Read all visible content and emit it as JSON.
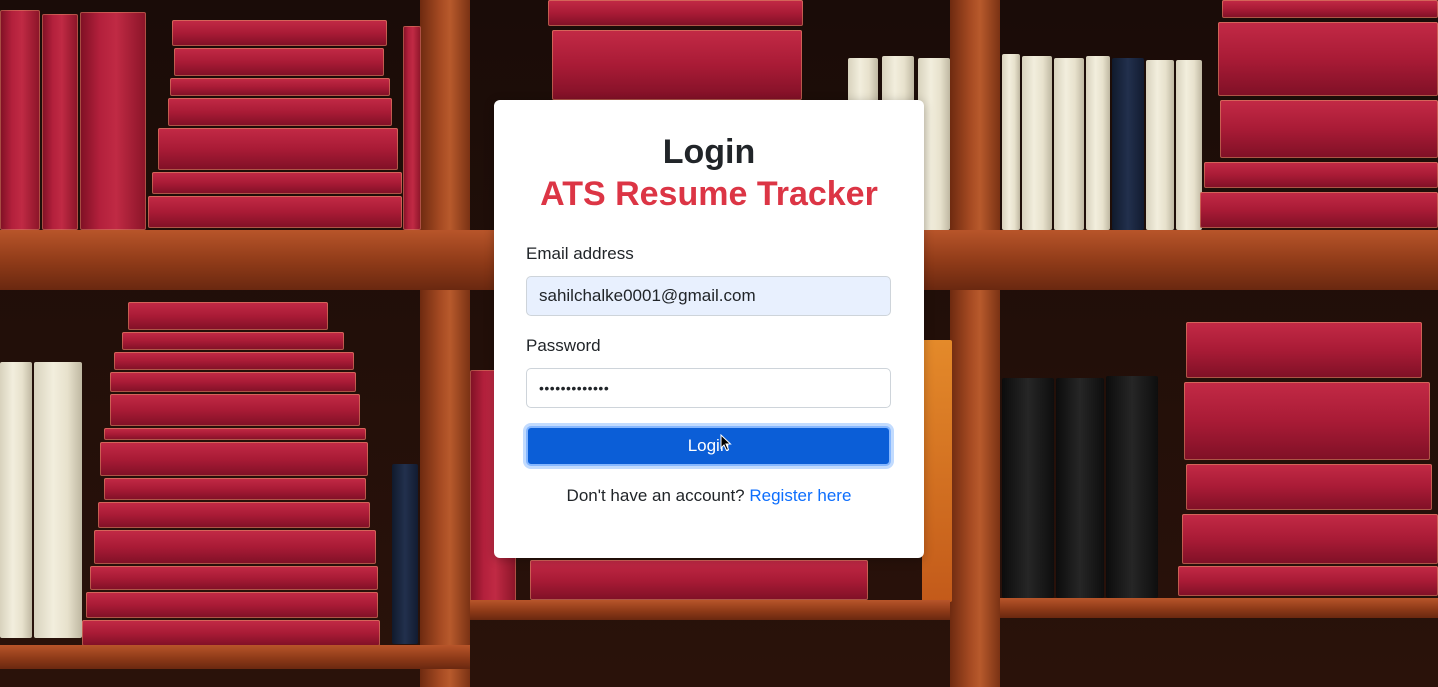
{
  "login": {
    "title": "Login",
    "subtitle": "ATS Resume Tracker",
    "email_label": "Email address",
    "email_value": "sahilchalke0001@gmail.com",
    "password_label": "Password",
    "password_mask": "•••••••••••••",
    "submit_label": "Login",
    "register_prompt": "Don't have an account?",
    "register_link": "Register here"
  },
  "colors": {
    "accent": "#0b5ed7",
    "subtitle": "#dc3545",
    "link": "#0d6efd",
    "autofill_bg": "#e8f0fe"
  },
  "icons": {
    "cursor": "mouse-pointer-icon"
  }
}
